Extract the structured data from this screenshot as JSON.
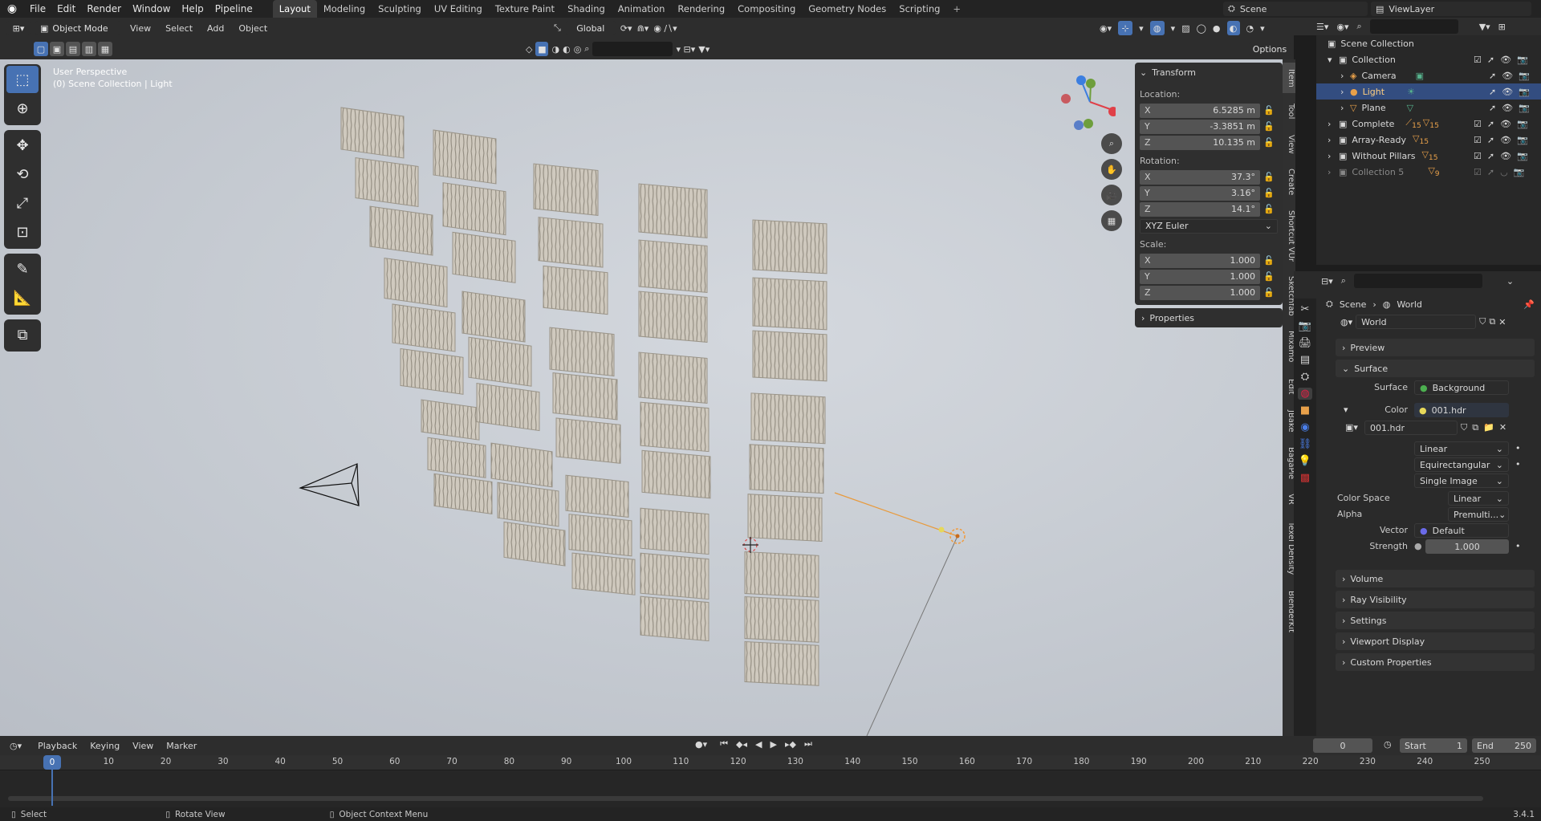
{
  "topbar": {
    "menus": [
      "File",
      "Edit",
      "Render",
      "Window",
      "Help",
      "Pipeline"
    ],
    "tabs": [
      "Layout",
      "Modeling",
      "Sculpting",
      "UV Editing",
      "Texture Paint",
      "Shading",
      "Animation",
      "Rendering",
      "Compositing",
      "Geometry Nodes",
      "Scripting"
    ],
    "active_tab": "Layout",
    "scene": "Scene",
    "view_layer": "ViewLayer"
  },
  "viewport_header": {
    "mode": "Object Mode",
    "menus": [
      "View",
      "Select",
      "Add",
      "Object"
    ],
    "orientation": "Global",
    "options_label": "Options"
  },
  "viewport": {
    "perspective_label": "User Perspective",
    "context_label": "(0) Scene Collection | Light"
  },
  "npanel": {
    "title": "Transform",
    "location_label": "Location:",
    "location": [
      {
        "axis": "X",
        "value": "6.5285 m"
      },
      {
        "axis": "Y",
        "value": "-3.3851 m"
      },
      {
        "axis": "Z",
        "value": "10.135 m"
      }
    ],
    "rotation_label": "Rotation:",
    "rotation": [
      {
        "axis": "X",
        "value": "37.3°"
      },
      {
        "axis": "Y",
        "value": "3.16°"
      },
      {
        "axis": "Z",
        "value": "14.1°"
      }
    ],
    "rotation_mode": "XYZ Euler",
    "scale_label": "Scale:",
    "scale": [
      {
        "axis": "X",
        "value": "1.000"
      },
      {
        "axis": "Y",
        "value": "1.000"
      },
      {
        "axis": "Z",
        "value": "1.000"
      }
    ],
    "properties_label": "Properties"
  },
  "side_tabs": [
    "Item",
    "Tool",
    "View",
    "Create",
    "Shortcut VUr",
    "Sketchfab",
    "Mixamo",
    "Edit",
    "JBake",
    "BagaPie",
    "VR",
    "Texel Density",
    "BlenderKit"
  ],
  "outliner": {
    "root": "Scene Collection",
    "collection": "Collection",
    "children": [
      "Camera",
      "Light",
      "Plane"
    ],
    "others": [
      "Complete",
      "Array-Ready",
      "Without Pillars",
      "Collection 5"
    ],
    "badges": {
      "complete_a": "15",
      "complete_b": "15",
      "array": "15",
      "without": "15",
      "coll5": "9"
    }
  },
  "properties": {
    "breadcrumb_scene": "Scene",
    "breadcrumb_world": "World",
    "world_name": "World",
    "sections": {
      "preview": "Preview",
      "surface": "Surface",
      "volume": "Volume",
      "ray_visibility": "Ray Visibility",
      "settings": "Settings",
      "viewport_display": "Viewport Display",
      "custom_properties": "Custom Properties"
    },
    "surface_label": "Surface",
    "surface_value": "Background",
    "color_label": "Color",
    "color_value": "001.hdr",
    "image_name": "001.hdr",
    "interp": "Linear",
    "projection": "Equirectangular",
    "source": "Single Image",
    "color_space_label": "Color Space",
    "color_space": "Linear",
    "alpha_label": "Alpha",
    "alpha": "Premulti...",
    "vector_label": "Vector",
    "vector": "Default",
    "strength_label": "Strength",
    "strength": "1.000"
  },
  "timeline": {
    "menus": [
      "Playback",
      "Keying",
      "View",
      "Marker"
    ],
    "current_frame": "0",
    "start_label": "Start",
    "start": "1",
    "end_label": "End",
    "end": "250",
    "ticks": [
      "0",
      "10",
      "20",
      "30",
      "40",
      "50",
      "60",
      "70",
      "80",
      "90",
      "100",
      "110",
      "120",
      "130",
      "140",
      "150",
      "160",
      "170",
      "180",
      "190",
      "200",
      "210",
      "220",
      "230",
      "240",
      "250"
    ]
  },
  "statusbar": {
    "select": "Select",
    "rotate": "Rotate View",
    "context_menu": "Object Context Menu",
    "version": "3.4.1"
  }
}
